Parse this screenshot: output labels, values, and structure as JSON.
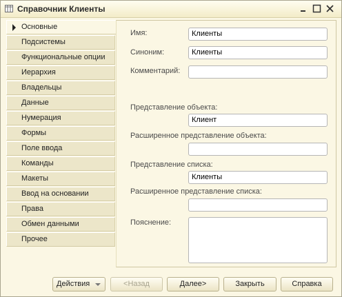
{
  "window": {
    "title": "Справочник Клиенты"
  },
  "tabs": [
    {
      "label": "Основные",
      "active": true
    },
    {
      "label": "Подсистемы"
    },
    {
      "label": "Функциональные опции"
    },
    {
      "label": "Иерархия"
    },
    {
      "label": "Владельцы"
    },
    {
      "label": "Данные"
    },
    {
      "label": "Нумерация"
    },
    {
      "label": "Формы"
    },
    {
      "label": "Поле ввода"
    },
    {
      "label": "Команды"
    },
    {
      "label": "Макеты"
    },
    {
      "label": "Ввод на основании"
    },
    {
      "label": "Права"
    },
    {
      "label": "Обмен данными"
    },
    {
      "label": "Прочее"
    }
  ],
  "form": {
    "name_label": "Имя:",
    "name_value": "Клиенты",
    "synonym_label": "Синоним:",
    "synonym_value": "Клиенты",
    "comment_label": "Комментарий:",
    "comment_value": "",
    "object_repr_label": "Представление объекта:",
    "object_repr_value": "Клиент",
    "ext_object_repr_label": "Расширенное представление объекта:",
    "ext_object_repr_value": "",
    "list_repr_label": "Представление списка:",
    "list_repr_value": "Клиенты",
    "ext_list_repr_label": "Расширенное представление списка:",
    "ext_list_repr_value": "",
    "explanation_label": "Пояснение:",
    "explanation_value": ""
  },
  "buttons": {
    "actions": "Действия",
    "back": "<Назад",
    "next": "Далее>",
    "close": "Закрыть",
    "help": "Справка"
  },
  "colors": {
    "window_bg": "#fbf7e4",
    "tab_bg": "#ece6c9",
    "border": "#a9a58f"
  },
  "icons": {
    "app": "table-icon",
    "menu": "minimize-icon",
    "maximize": "maximize-icon",
    "close": "close-icon"
  }
}
